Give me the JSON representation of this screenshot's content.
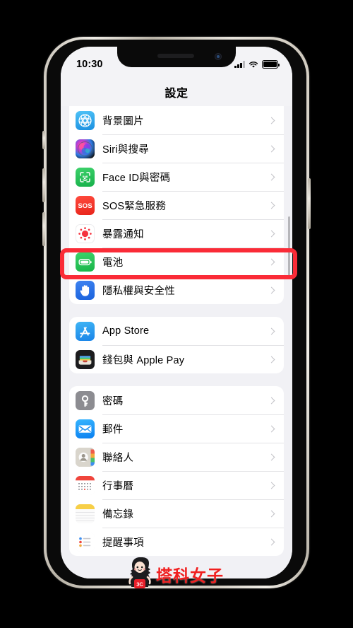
{
  "device": {
    "frame_color": "#d8d3c9",
    "screen_bg": "#f1f1f5",
    "buttons": {
      "mute_switch": "mute-switch",
      "volume_up": "volume-up-button",
      "volume_down": "volume-down-button",
      "power": "power-button"
    }
  },
  "status_bar": {
    "time": "10:30",
    "cellular_icon": "signal-bars-icon",
    "wifi_icon": "wifi-icon",
    "battery_icon": "battery-icon",
    "battery_full": true
  },
  "navbar": {
    "title": "設定"
  },
  "highlight": {
    "color": "#fa2b37",
    "target_row": "電池"
  },
  "watermark": {
    "text": "塔科女子",
    "badge": "3C",
    "color": "#f02020"
  },
  "groups": [
    {
      "name": "group-system",
      "rows": [
        {
          "label": "背景圖片",
          "icon": "wallpaper-icon",
          "icon_class": "ic-wallpaper",
          "chevron": true
        },
        {
          "label": "Siri與搜尋",
          "icon": "siri-icon",
          "icon_class": "ic-siri",
          "chevron": true
        },
        {
          "label": "Face ID與密碼",
          "icon": "faceid-icon",
          "icon_class": "ic-faceid",
          "chevron": true
        },
        {
          "label": "SOS緊急服務",
          "icon": "sos-icon",
          "icon_class": "ic-sos",
          "chevron": true
        },
        {
          "label": "暴露通知",
          "icon": "exposure-notification-icon",
          "icon_class": "ic-exposure",
          "chevron": true
        },
        {
          "label": "電池",
          "icon": "battery-settings-icon",
          "icon_class": "ic-battery",
          "chevron": true,
          "highlighted": true
        },
        {
          "label": "隱私權與安全性",
          "icon": "privacy-hand-icon",
          "icon_class": "ic-privacy",
          "chevron": true
        }
      ]
    },
    {
      "name": "group-store",
      "rows": [
        {
          "label": "App Store",
          "icon": "app-store-icon",
          "icon_class": "ic-appstore",
          "chevron": true
        },
        {
          "label": "錢包與 Apple Pay",
          "icon": "wallet-icon",
          "icon_class": "ic-wallet",
          "chevron": true
        }
      ]
    },
    {
      "name": "group-apps",
      "rows": [
        {
          "label": "密碼",
          "icon": "passwords-key-icon",
          "icon_class": "ic-passwords",
          "chevron": true
        },
        {
          "label": "郵件",
          "icon": "mail-icon",
          "icon_class": "ic-mail",
          "chevron": true
        },
        {
          "label": "聯絡人",
          "icon": "contacts-icon",
          "icon_class": "ic-contacts",
          "chevron": true
        },
        {
          "label": "行事曆",
          "icon": "calendar-icon",
          "icon_class": "ic-calendar",
          "chevron": true
        },
        {
          "label": "備忘錄",
          "icon": "notes-icon",
          "icon_class": "ic-notes",
          "chevron": true
        },
        {
          "label": "提醒事項",
          "icon": "reminders-icon",
          "icon_class": "ic-reminders",
          "chevron": true
        }
      ]
    }
  ]
}
